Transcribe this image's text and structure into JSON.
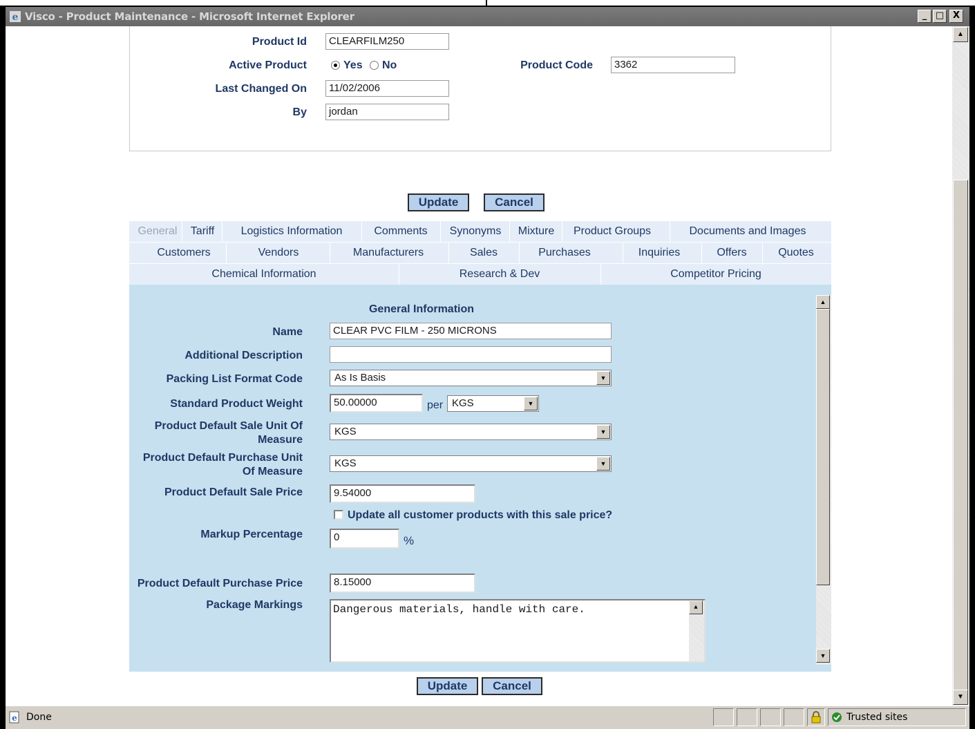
{
  "window": {
    "title": "Visco - Product Maintenance - Microsoft Internet Explorer",
    "controls": {
      "minimize": "_",
      "maximize": "□",
      "close": "X"
    }
  },
  "header_form": {
    "product_id": {
      "label": "Product Id",
      "value": "CLEARFILM250"
    },
    "active_product": {
      "label": "Active Product",
      "yes": "Yes",
      "no": "No",
      "selected": "Yes"
    },
    "product_code": {
      "label": "Product Code",
      "value": "3362"
    },
    "last_changed_on": {
      "label": "Last Changed On",
      "value": "11/02/2006"
    },
    "by": {
      "label": "By",
      "value": "jordan"
    }
  },
  "buttons": {
    "update": "Update",
    "cancel": "Cancel"
  },
  "tabs": {
    "row1": [
      "General",
      "Tariff",
      "Logistics Information",
      "Comments",
      "Synonyms",
      "Mixture",
      "Product Groups",
      "Documents and Images"
    ],
    "row2": [
      "Customers",
      "Vendors",
      "Manufacturers",
      "Sales",
      "Purchases",
      "Inquiries",
      "Offers",
      "Quotes"
    ],
    "row3": [
      "Chemical Information",
      "Research & Dev",
      "Competitor Pricing"
    ],
    "active": "General"
  },
  "general": {
    "heading": "General Information",
    "name": {
      "label": "Name",
      "value": "CLEAR PVC FILM - 250 MICRONS"
    },
    "additional_description": {
      "label": "Additional Description",
      "value": ""
    },
    "packing_list_format_code": {
      "label": "Packing List Format Code",
      "value": "As Is Basis"
    },
    "standard_product_weight": {
      "label": "Standard Product Weight",
      "value": "50.00000",
      "per": "per",
      "unit": "KGS"
    },
    "default_sale_uom": {
      "label_line1": "Product Default Sale Unit Of",
      "label_line2": "Measure",
      "value": "KGS"
    },
    "default_purchase_uom": {
      "label_line1": "Product Default Purchase Unit",
      "label_line2": "Of Measure",
      "value": "KGS"
    },
    "default_sale_price": {
      "label": "Product Default Sale Price",
      "value": "9.54000"
    },
    "update_customer_products": {
      "label": "Update all customer products with this sale price?",
      "checked": false
    },
    "markup_percentage": {
      "label": "Markup Percentage",
      "value": "0",
      "unit": "%"
    },
    "default_purchase_price": {
      "label": "Product Default Purchase Price",
      "value": "8.15000"
    },
    "package_markings": {
      "label": "Package Markings",
      "value": "Dangerous materials, handle with care."
    }
  },
  "status_bar": {
    "text": "Done",
    "zone": "Trusted sites"
  },
  "colors": {
    "label": "#1f3864",
    "panel": "#c6e0f0",
    "tab_bg": "#e5eef8",
    "button": "#b8d0ec"
  }
}
